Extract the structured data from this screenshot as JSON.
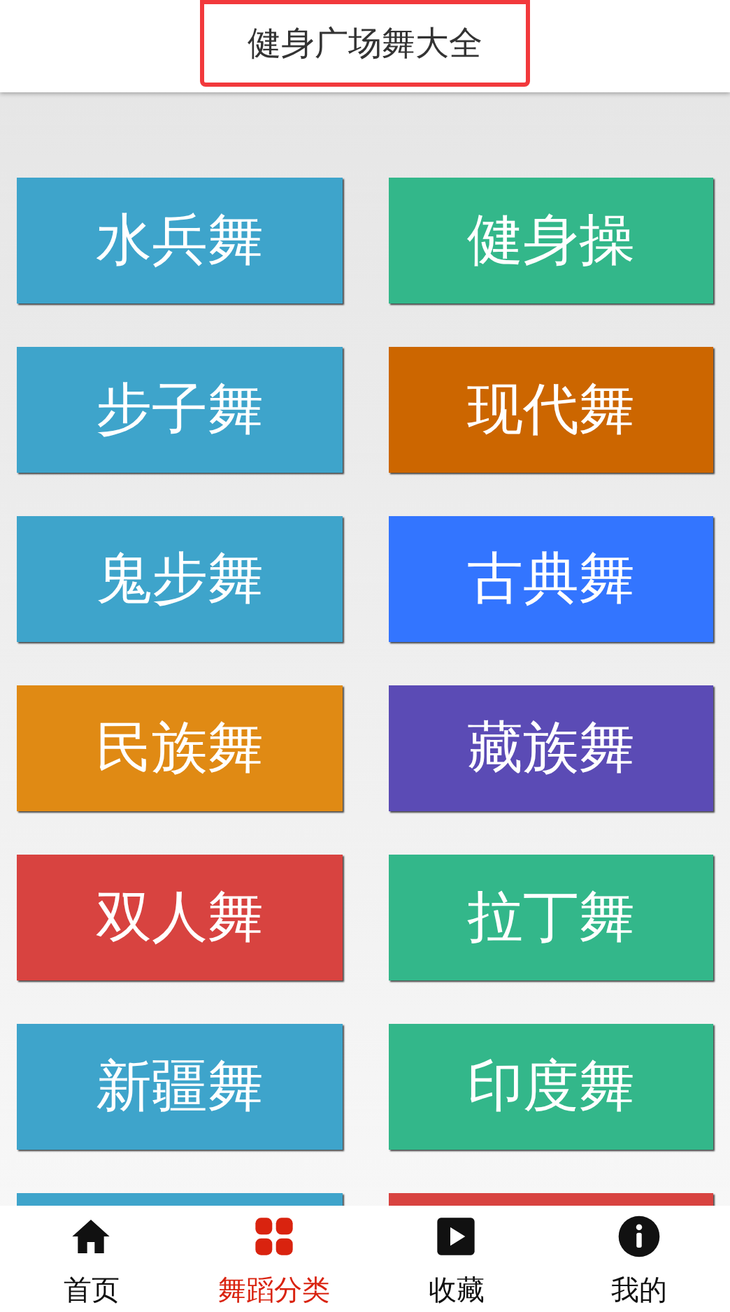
{
  "header": {
    "title": "健身广场舞大全"
  },
  "categories": [
    {
      "label": "水兵舞",
      "color": "#3ea4cb"
    },
    {
      "label": "健身操",
      "color": "#33b78a"
    },
    {
      "label": "步子舞",
      "color": "#3ea4cb"
    },
    {
      "label": "现代舞",
      "color": "#cc6600"
    },
    {
      "label": "鬼步舞",
      "color": "#3ea4cb"
    },
    {
      "label": "古典舞",
      "color": "#3375ff"
    },
    {
      "label": "民族舞",
      "color": "#e08a14"
    },
    {
      "label": "藏族舞",
      "color": "#5b4bb5"
    },
    {
      "label": "双人舞",
      "color": "#d84340"
    },
    {
      "label": "拉丁舞",
      "color": "#33b78a"
    },
    {
      "label": "新疆舞",
      "color": "#3ea4cb"
    },
    {
      "label": "印度舞",
      "color": "#33b78a"
    },
    {
      "color": "#3ea4cb"
    },
    {
      "color": "#d84340"
    }
  ],
  "tab_bar": [
    {
      "kind": "home",
      "label": "首页",
      "selected": false
    },
    {
      "kind": "grid",
      "label": "舞蹈分类",
      "selected": true
    },
    {
      "kind": "play",
      "label": "收藏",
      "selected": false
    },
    {
      "kind": "info",
      "label": "我的",
      "selected": false
    }
  ]
}
